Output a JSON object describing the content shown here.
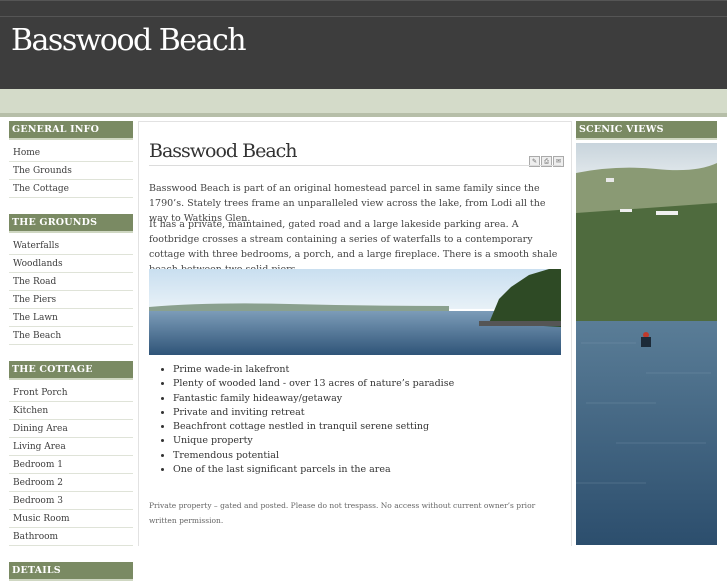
{
  "site": {
    "title": "Basswood Beach"
  },
  "sidebar": {
    "sections": [
      {
        "heading": "GENERAL INFO",
        "items": [
          "Home",
          "The Grounds",
          "The Cottage"
        ]
      },
      {
        "heading": "THE GROUNDS",
        "items": [
          "Waterfalls",
          "Woodlands",
          "The Road",
          "The Piers",
          "The Lawn",
          "The Beach"
        ]
      },
      {
        "heading": "THE COTTAGE",
        "items": [
          "Front Porch",
          "Kitchen",
          "Dining Area",
          "Living Area",
          "Bedroom 1",
          "Bedroom 2",
          "Bedroom 3",
          "Music Room",
          "Bathroom"
        ]
      },
      {
        "heading": "DETAILS",
        "items": []
      }
    ]
  },
  "main": {
    "title": "Basswood Beach",
    "icons": [
      "pdf-icon",
      "print-icon",
      "email-icon"
    ],
    "paragraph1": "Basswood Beach is part of an original homestead parcel in same family since the 1790’s. Stately trees frame an unparalleled view across the lake, from Lodi all the way to Watkins Glen.",
    "paragraph2": "It has a private, maintained, gated road and a large lakeside parking area. A footbridge crosses a stream containing a series of waterfalls to a contemporary cottage with three bedrooms, a porch, and a large fireplace. There is a smooth shale beach between two solid piers.",
    "bullets": [
      "Prime wade-in lakefront",
      "Plenty of wooded land - over 13 acres of nature’s paradise",
      "Fantastic family hideaway/getaway",
      "Private and inviting retreat",
      "Beachfront cottage nestled in tranquil serene setting",
      "Unique property",
      "Tremendous potential",
      "One of the last significant parcels in the area"
    ],
    "footer_note": "Private property – gated and posted. Please do not trespass. No access without current owner’s prior written permission."
  },
  "right": {
    "heading": "SCENIC VIEWS"
  },
  "colors": {
    "header_bg": "#3d3d3d",
    "band": "#d4dbc9",
    "section_head": "#7a8a63"
  }
}
